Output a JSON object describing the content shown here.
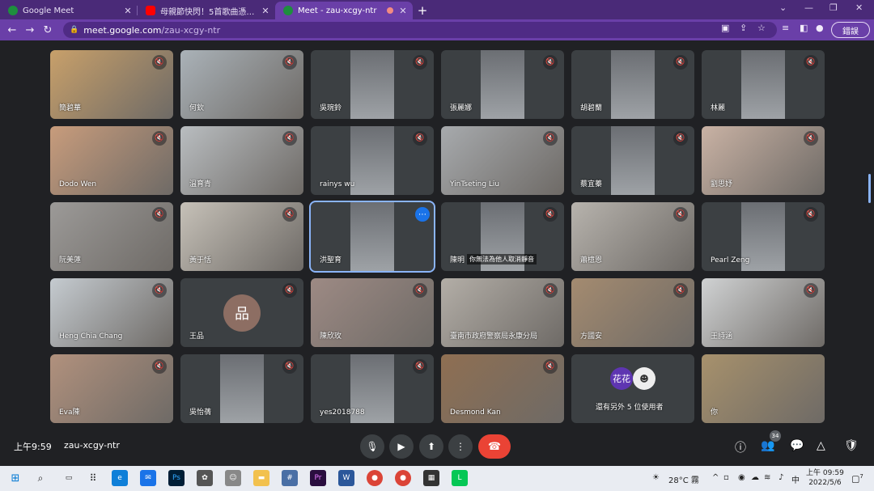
{
  "browser": {
    "tabs": [
      {
        "title": "Google Meet",
        "favicon_color": "#1e8e3e"
      },
      {
        "title": "母親節快閃！5首歌曲憑爆永康廟",
        "favicon_color": "#ff0000"
      },
      {
        "title": "Meet - zau-xcgy-ntr",
        "favicon_color": "#1e8e3e",
        "active": true
      }
    ],
    "url_host": "meet.google.com",
    "url_path": "/zau-xcgy-ntr",
    "profile_button": "錯誤"
  },
  "tiles": [
    {
      "name": "簡碧華",
      "bg": "#c8a06a"
    },
    {
      "name": "何欽",
      "bg": "#aab2b8"
    },
    {
      "name": "吳琬鈴",
      "bg": "#5b5f63"
    },
    {
      "name": "張麗娜",
      "bg": "#5b5f63"
    },
    {
      "name": "胡碧蘭",
      "bg": "#5b5f63"
    },
    {
      "name": "林麗",
      "bg": "#5b5f63"
    },
    {
      "name": "Dodo Wen",
      "bg": "#c89c7c"
    },
    {
      "name": "溫育青",
      "bg": "#b9bdc0"
    },
    {
      "name": "rainys wu",
      "bg": "#5b5f63"
    },
    {
      "name": "YinTseting Liu",
      "bg": "#a7aaad"
    },
    {
      "name": "蔡宜蓁",
      "bg": "#5b5f63"
    },
    {
      "name": "劉思妤",
      "bg": "#c9b2a4"
    },
    {
      "name": "阮美蓮",
      "bg": "#9c9a98"
    },
    {
      "name": "黃于恬",
      "bg": "#c6c1b8"
    },
    {
      "name": "洪聖育",
      "bg": "#5b5f63",
      "highlight": true
    },
    {
      "name": "陳明",
      "bg": "#5b5f63",
      "notice": "你無法為他人取消靜音"
    },
    {
      "name": "蕭檍恩",
      "bg": "#b7b3ad"
    },
    {
      "name": "Pearl Zeng",
      "bg": "#5b5f63"
    },
    {
      "name": "Heng Chia Chang",
      "bg": "#c5cbd0"
    },
    {
      "name": "王品",
      "bg": "#3c4043",
      "avatar": "品"
    },
    {
      "name": "陳欣玫",
      "bg": "#9d8a84"
    },
    {
      "name": "臺南市政府警察局永康分局",
      "bg": "#b3aea7"
    },
    {
      "name": "方國安",
      "bg": "#a48b70"
    },
    {
      "name": "王詩涵",
      "bg": "#d0d2d3"
    },
    {
      "name": "Eva陳",
      "bg": "#b1917d"
    },
    {
      "name": "吳怡蒨",
      "bg": "#5b5f63"
    },
    {
      "name": "yes2018788",
      "bg": "#5b5f63"
    },
    {
      "name": "Desmond Kan",
      "bg": "#8f6f52"
    },
    {
      "name": "還有另外 5 位使用者",
      "bg": "#3c4043",
      "others": "花花"
    },
    {
      "name": "你",
      "bg": "#a7916c"
    }
  ],
  "bottom": {
    "time": "上午9:59",
    "meeting_code": "zau-xcgy-ntr",
    "participant_count": "34"
  },
  "taskbar": {
    "weather": "28°C 霧",
    "ime": "中",
    "time": "上午 09:59",
    "date": "2022/5/6",
    "notifications": "7"
  }
}
